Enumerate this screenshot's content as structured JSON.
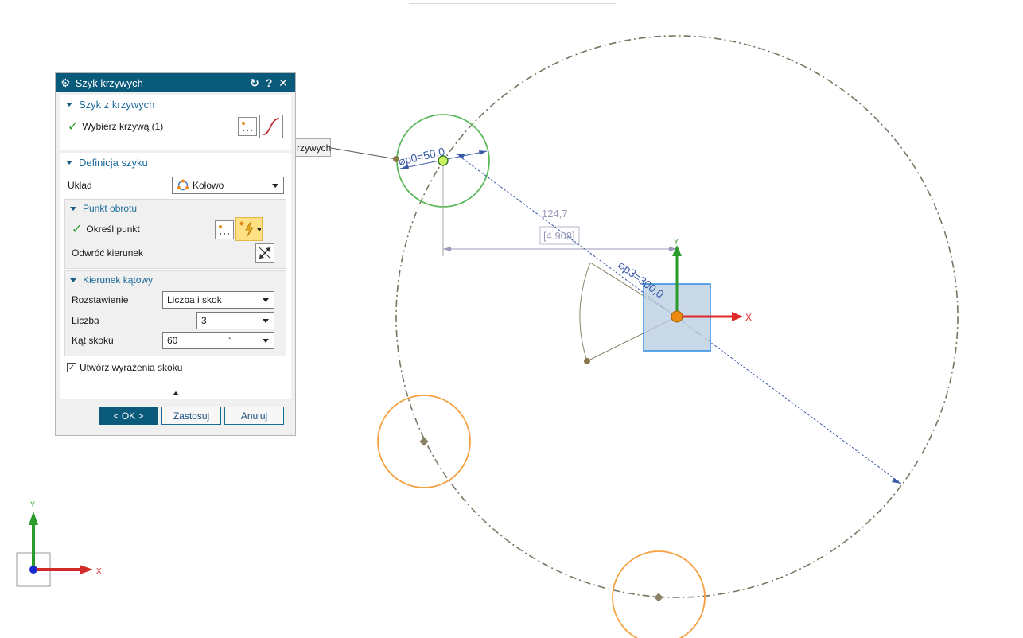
{
  "dialog": {
    "title": "Szyk krzywych",
    "sections": {
      "curves": {
        "title": "Szyk z krzywych",
        "select_label": "Wybierz krzywą (1)"
      },
      "definition": {
        "title": "Definicja szyku",
        "layout_label": "Układ",
        "layout_value": "Kołowo",
        "pivot": {
          "title": "Punkt obrotu",
          "specify_label": "Określ punkt",
          "reverse_label": "Odwróć kierunek"
        },
        "angular": {
          "title": "Kierunek kątowy",
          "spacing_label": "Rozstawienie",
          "spacing_value": "Liczba i skok",
          "count_label": "Liczba",
          "count_value": "3",
          "pitch_label": "Kąt skoku",
          "pitch_value": "60",
          "pitch_unit": "°"
        },
        "create_expr_label": "Utwórz wyrażenia skoku"
      }
    },
    "buttons": {
      "ok": "< OK >",
      "apply": "Zastosuj",
      "cancel": "Anuluj"
    }
  },
  "tooltip": {
    "text": "rzywych"
  },
  "viewport": {
    "dim_p0": "⌀p0=50,0",
    "dim_p3": "⌀p3=300,0",
    "dim_horizontal": "124,7",
    "dim_ref": "[4.908]",
    "axis_x": "X",
    "axis_y": "Y",
    "triad_x": "X",
    "triad_y": "Y"
  },
  "colors": {
    "titlebar": "#0a5a7c",
    "accent": "#1a6a9a",
    "green_circle": "#5bb85b",
    "orange_circle": "#f5a040",
    "dim_blue": "#3a5aa8",
    "big_circle": "#7a7560"
  }
}
